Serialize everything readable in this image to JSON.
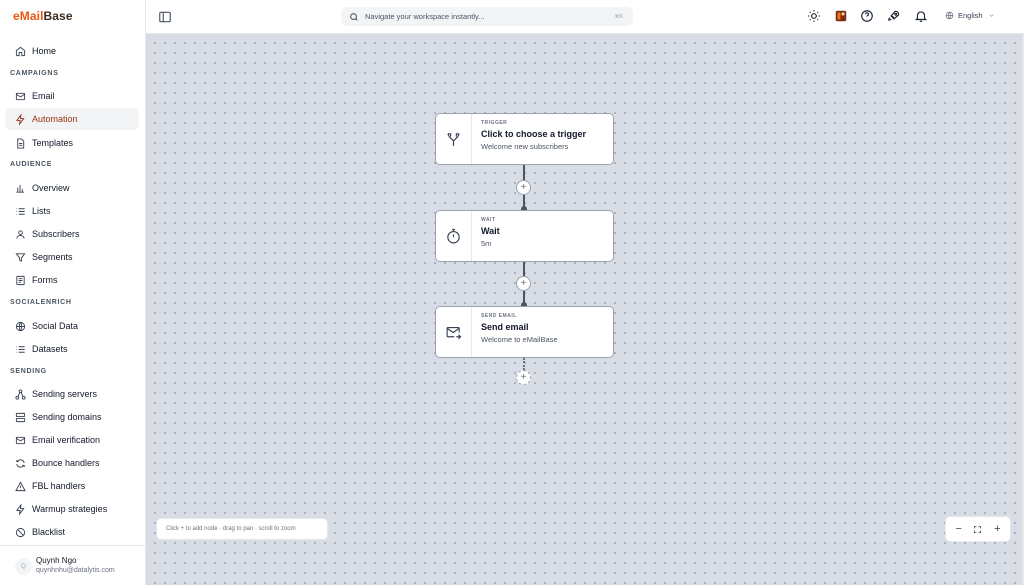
{
  "app": {
    "logo_prefix": "eMail",
    "logo_suffix": "Base"
  },
  "sidebar": {
    "sections": {
      "campaigns": "CAMPAIGNS",
      "audience": "AUDIENCE",
      "socialenrich": "SOCIALENRICH",
      "sending": "SENDING"
    },
    "items": [
      {
        "label": "Home",
        "icon": "home-icon"
      },
      {
        "label": "Email",
        "icon": "mail-icon"
      },
      {
        "label": "Automation",
        "icon": "bolt-icon",
        "active": true
      },
      {
        "label": "Templates",
        "icon": "document-icon"
      },
      {
        "label": "Overview",
        "icon": "bar-chart-icon"
      },
      {
        "label": "Lists",
        "icon": "list-icon"
      },
      {
        "label": "Subscribers",
        "icon": "user-icon"
      },
      {
        "label": "Segments",
        "icon": "filter-icon"
      },
      {
        "label": "Forms",
        "icon": "form-icon"
      },
      {
        "label": "Social Data",
        "icon": "globe-icon"
      },
      {
        "label": "Datasets",
        "icon": "list-icon"
      },
      {
        "label": "Sending servers",
        "icon": "network-icon"
      },
      {
        "label": "Sending domains",
        "icon": "server-icon"
      },
      {
        "label": "Email verification",
        "icon": "mail-check-icon"
      },
      {
        "label": "Bounce handlers",
        "icon": "refresh-icon"
      },
      {
        "label": "FBL handlers",
        "icon": "warning-icon"
      },
      {
        "label": "Warmup strategies",
        "icon": "bolt-icon"
      },
      {
        "label": "Blacklist",
        "icon": "ban-icon"
      }
    ],
    "user": {
      "initial": "Q",
      "name": "Quynh Ngo",
      "email": "quynhnhu@datalytis.com"
    }
  },
  "header": {
    "search": {
      "placeholder": "Navigate your workspace instantly...",
      "shortcut": "⌘K"
    },
    "language": "English",
    "icons": [
      "sun-icon",
      "brand-app-icon",
      "help-icon",
      "rocket-icon",
      "bell-icon"
    ]
  },
  "workflow": {
    "nodes": [
      {
        "kind": "TRIGGER",
        "title": "Click to choose a trigger",
        "subtitle": "Welcome new subscribers",
        "icon": "split-icon"
      },
      {
        "kind": "WAIT",
        "title": "Wait",
        "subtitle": "5m",
        "icon": "timer-icon"
      },
      {
        "kind": "SEND EMAIL",
        "title": "Send email",
        "subtitle": "Welcome to eMailBase",
        "icon": "mail-send-icon"
      }
    ],
    "add_symbol": "+",
    "hint": "Click + to add node · drag to pan · scroll to zoom",
    "zoom_controls": {
      "out": "−",
      "in": "+"
    }
  },
  "colors": {
    "accent": "#ea580c",
    "canvas": "#d8dde5",
    "active_text": "#9a3412"
  }
}
